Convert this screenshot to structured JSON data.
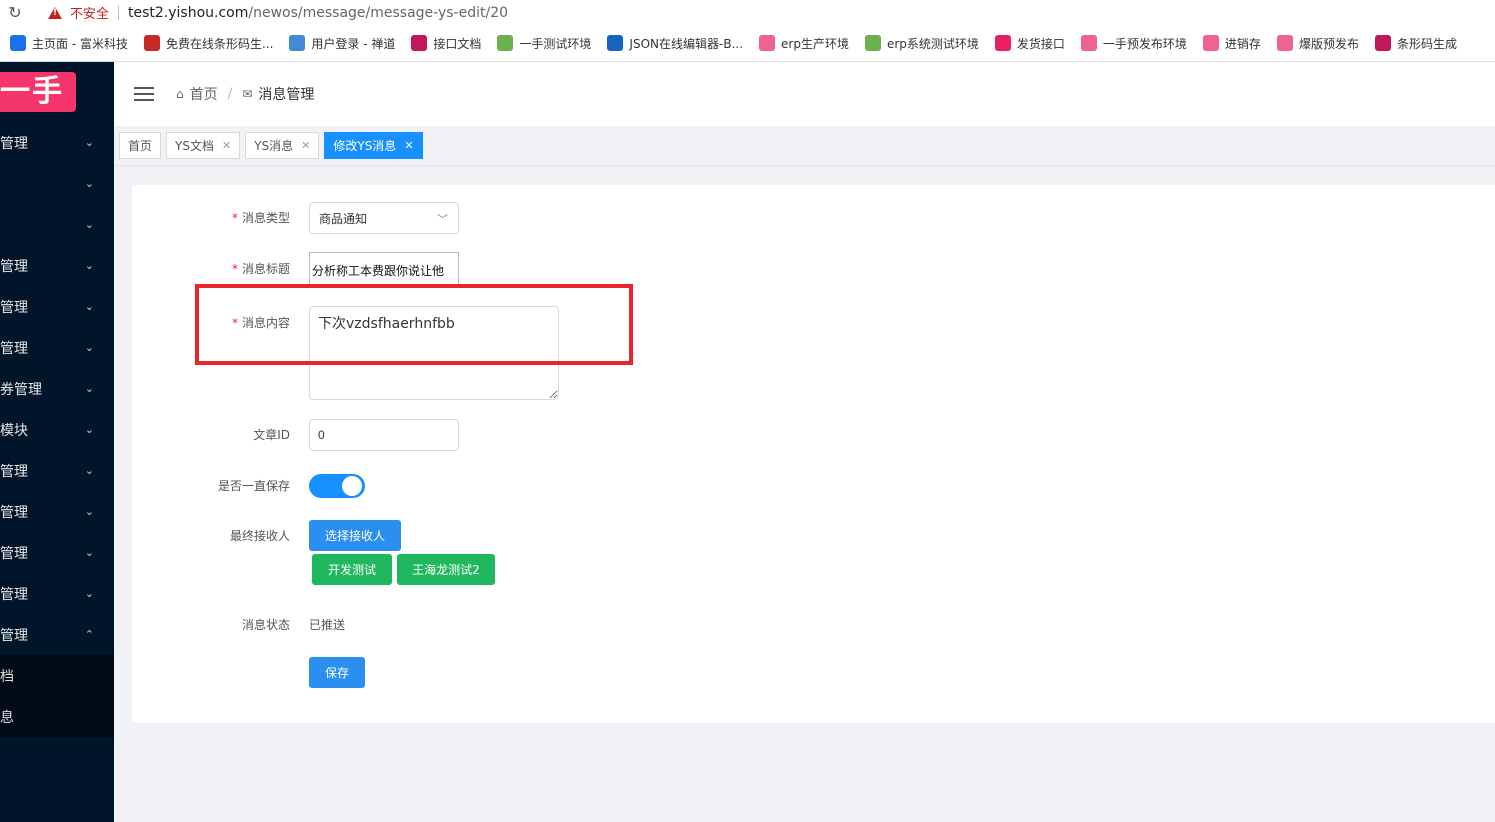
{
  "browser": {
    "warning_text": "不安全",
    "url_host": "test2.yishou.com",
    "url_path": "/newos/message/message-ys-edit/20",
    "bookmarks": [
      {
        "label": "主页面 - 富米科技",
        "icon_color": "#1a73e8"
      },
      {
        "label": "免费在线条形码生...",
        "icon_color": "#c62828"
      },
      {
        "label": "用户登录 - 禅道",
        "icon_color": "#3f8bd8"
      },
      {
        "label": "接口文档",
        "icon_color": "#c2185b"
      },
      {
        "label": "一手测试环境",
        "icon_color": "#6ab04c"
      },
      {
        "label": "JSON在线编辑器-B...",
        "icon_color": "#1565c0"
      },
      {
        "label": "erp生产环境",
        "icon_color": "#f06292"
      },
      {
        "label": "erp系统测试环境",
        "icon_color": "#6ab04c"
      },
      {
        "label": "发货接口",
        "icon_color": "#e91e63"
      },
      {
        "label": "一手预发布环境",
        "icon_color": "#f06292"
      },
      {
        "label": "进销存",
        "icon_color": "#f06292"
      },
      {
        "label": "爆版预发布",
        "icon_color": "#f06292"
      },
      {
        "label": "条形码生成",
        "icon_color": "#c2185b"
      }
    ]
  },
  "sidebar": {
    "logo_text": "一手",
    "items": [
      {
        "label": "管理",
        "chevron": "⌄"
      },
      {
        "label": "",
        "chevron": "⌄"
      },
      {
        "label": "",
        "chevron": "⌄"
      },
      {
        "label": "管理",
        "chevron": "⌄"
      },
      {
        "label": "管理",
        "chevron": "⌄"
      },
      {
        "label": "管理",
        "chevron": "⌄"
      },
      {
        "label": "券管理",
        "chevron": "⌄"
      },
      {
        "label": "模块",
        "chevron": "⌄"
      },
      {
        "label": "管理",
        "chevron": "⌄"
      },
      {
        "label": "管理",
        "chevron": "⌄"
      },
      {
        "label": "管理",
        "chevron": "⌄"
      },
      {
        "label": "管理",
        "chevron": "⌄"
      },
      {
        "label": "管理",
        "chevron": "⌃"
      }
    ],
    "sub_items": [
      {
        "label": "档"
      },
      {
        "label": "息"
      }
    ]
  },
  "header": {
    "breadcrumb_home": "首页",
    "breadcrumb_current": "消息管理"
  },
  "tabs": [
    {
      "label": "首页",
      "closable": false
    },
    {
      "label": "YS文档",
      "closable": true
    },
    {
      "label": "YS消息",
      "closable": true
    },
    {
      "label": "修改YS消息",
      "closable": true
    }
  ],
  "form": {
    "type_label": "消息类型",
    "type_value": "商品通知",
    "title_label": "消息标题",
    "title_value": "分析称工本费跟你说让他",
    "content_label": "消息内容",
    "content_value": "下次vzdsfhaerhnfbb",
    "article_label": "文章ID",
    "article_value": "0",
    "keep_label": "是否一直保存",
    "keep_on": true,
    "receiver_label": "最终接收人",
    "select_receiver_button": "选择接收人",
    "receivers": [
      "开发测试",
      "王海龙测试2"
    ],
    "status_label": "消息状态",
    "status_value": "已推送",
    "save_button": "保存"
  },
  "colors": {
    "primary": "#1890ff",
    "success": "#20b85e",
    "sidebar_bg": "#001529",
    "logo_bg": "#f5366b",
    "highlight_border": "#e8262c"
  }
}
